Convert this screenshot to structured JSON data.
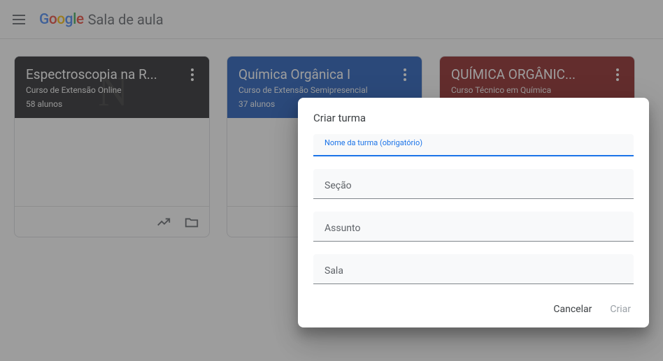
{
  "header": {
    "app_name": "Sala de aula",
    "logo_letters": [
      "G",
      "o",
      "o",
      "g",
      "l",
      "e"
    ]
  },
  "cards": [
    {
      "title": "Espectroscopia na R...",
      "subtitle": "Curso de Extensão Online",
      "students": "58 alunos"
    },
    {
      "title": "Química Orgânica I",
      "subtitle": "Curso de Extensão Semipresencial",
      "students": "37 alunos"
    },
    {
      "title": "QUÍMICA ORGÂNIC...",
      "subtitle": "Curso Técnico em Química",
      "students": ""
    }
  ],
  "dialog": {
    "title": "Criar turma",
    "fields": {
      "name_label": "Nome da turma (obrigatório)",
      "section_label": "Seção",
      "subject_label": "Assunto",
      "room_label": "Sala"
    },
    "actions": {
      "cancel": "Cancelar",
      "create": "Criar"
    }
  }
}
